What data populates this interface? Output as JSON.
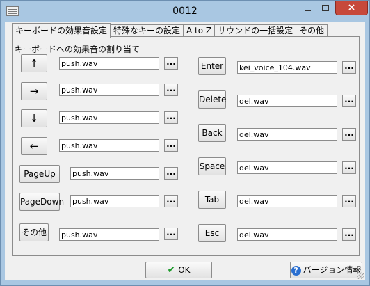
{
  "window": {
    "title": "0012",
    "close_glyph": "×"
  },
  "tabs": [
    {
      "label": "キーボードの効果音設定",
      "active": true
    },
    {
      "label": "特殊なキーの設定",
      "active": false
    },
    {
      "label": "A to Z",
      "active": false
    },
    {
      "label": "サウンドの一括設定",
      "active": false
    },
    {
      "label": "その他",
      "active": false
    }
  ],
  "section_label": "キーボードへの効果音の割り当て",
  "left_keys": [
    {
      "label": "↑",
      "file": "push.wav"
    },
    {
      "label": "→",
      "file": "push.wav"
    },
    {
      "label": "↓",
      "file": "push.wav"
    },
    {
      "label": "←",
      "file": "push.wav"
    },
    {
      "label": "PageUp",
      "file": "push.wav"
    },
    {
      "label": "PageDown",
      "file": "push.wav"
    },
    {
      "label": "その他",
      "file": "push.wav"
    }
  ],
  "right_keys": [
    {
      "label": "Enter",
      "file": "kei_voice_104.wav"
    },
    {
      "label": "Delete",
      "file": "del.wav"
    },
    {
      "label": "Back",
      "file": "del.wav"
    },
    {
      "label": "Space",
      "file": "del.wav"
    },
    {
      "label": "Tab",
      "file": "del.wav"
    },
    {
      "label": "Esc",
      "file": "del.wav"
    }
  ],
  "browse_label": "...",
  "footer": {
    "ok_label": "OK",
    "check_glyph": "✔",
    "version_label": "バージョン情報",
    "help_glyph": "?"
  }
}
